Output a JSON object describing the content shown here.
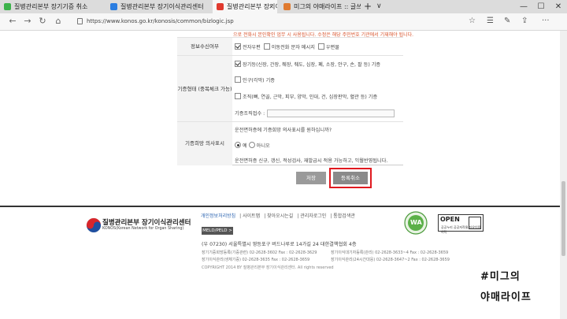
{
  "browser": {
    "tabs": [
      {
        "title": "질병관리본부 장기기증 취소",
        "active": false,
        "favicon_color": "#3cb24a"
      },
      {
        "title": "질병관리본부 장기이식관리센터",
        "active": false,
        "favicon_color": "#2a7de1"
      },
      {
        "title": "질병관리본부 장기이식",
        "active": true,
        "favicon_color": "#e03a2f"
      },
      {
        "title": "미그의 야매라이프 :: 글쓰기",
        "active": false,
        "favicon_color": "#e07a2f"
      }
    ],
    "new_tab_symbol": "+",
    "tab_menu_symbol": "∨",
    "window_controls": [
      "—",
      "☐",
      "✕"
    ],
    "url": "https://www.konos.go.kr/konosis/common/bizlogic.jsp",
    "nav": {
      "back": "←",
      "forward": "→",
      "refresh": "↻",
      "home": "⌂"
    },
    "right_icons": [
      "☆",
      "☰",
      "✎",
      "⇪",
      "···"
    ]
  },
  "form": {
    "top_note": "으로 전화시 본인확인 업무 시 사용됩니다. 수정은 해당 주민번호 기관에서 기재해야 됩니다.",
    "rows": [
      {
        "label": "정보수신여부",
        "options": [
          {
            "text": "전자우편",
            "checked": true
          },
          {
            "text": "이동전화 문자 메시지",
            "checked": false
          },
          {
            "text": "우편물",
            "checked": false
          }
        ]
      },
      {
        "label": "기증형태 (중복체크 가능)",
        "options": [
          {
            "text": "장기등(신장, 간장, 췌장, 췌도, 심장, 폐, 소장, 안구, 손, 팔 등) 기증",
            "checked": true
          },
          {
            "text": "인구(각막) 기증",
            "checked": false
          },
          {
            "text": "조직(뼈, 연골, 근막, 피부, 양막, 인대, 건, 심장판막, 혈관 등) 기증",
            "checked": false
          }
        ],
        "email_label": "기증조직접수 :"
      },
      {
        "label": "기증희망 의사표시",
        "question": "운전면허증에 기증희망 의사표시를 원하십니까?",
        "radios": [
          {
            "text": "예",
            "checked": true
          },
          {
            "text": "아니오",
            "checked": false
          }
        ],
        "note": "운전면허증 신규, 갱신, 적성검사, 재발급시 적용 가능하고, 익월반영됩니다."
      }
    ],
    "buttons": {
      "save": "저장",
      "cancel": "등록취소"
    },
    "highlight_color": "#e0191f"
  },
  "footer": {
    "org_name": "질병관리본부 장기이식관리센터",
    "org_sub": "KONOS(Korean Network for Organ Sharing)",
    "links": [
      "개인정보처리방침",
      "사이트맵",
      "찾아오시는길",
      "관리자로그인",
      "통합검색관"
    ],
    "meld_label": "MELD/PELD >",
    "address": "(우 07230)  서울특별시 영등포구 버드나루로 14가길 24 대한결핵협회 4층",
    "contacts": [
      "장기기증희망등록(기증관련) 02-2628-3602 Fax : 02-2628-3629",
      "장기이식대기자등록(관리) 02-2628-3633~4 Fax : 02-2628-3659",
      "장기이식관리(생체기증) 02-2628-3635 Fax : 02-2628-3659",
      "장기이식관리(24시간대응) 02-2628-3647~2 Fax : 02-2628-3659"
    ],
    "copyright": "COPYRIGHT 2014 BY 질병관리본부 장기이식관리센터. All rights reserved",
    "badge_wa": "WA",
    "badge_open": "OPEN",
    "badge_open_sub": "공공누리 공공저작물 자유이용허락"
  },
  "watermark": {
    "line1": "#미그의",
    "line2": "야매라이프"
  }
}
